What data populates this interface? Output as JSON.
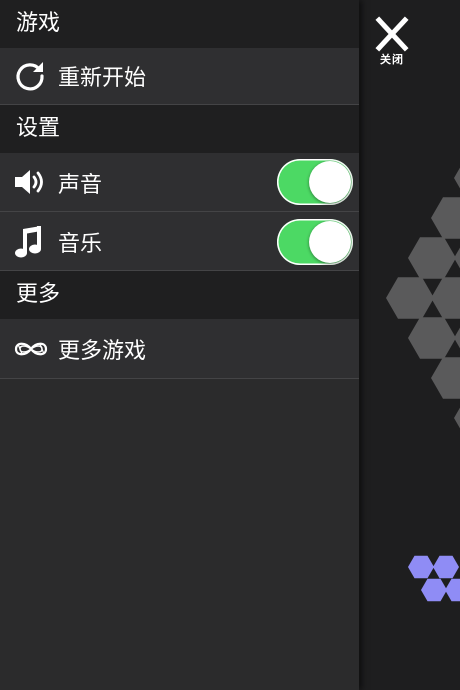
{
  "close": {
    "label": "关闭",
    "icon": "close-icon"
  },
  "sections": {
    "game": {
      "header": "游戏",
      "items": [
        {
          "label": "重新开始",
          "icon": "refresh-icon"
        }
      ]
    },
    "settings": {
      "header": "设置",
      "items": [
        {
          "label": "声音",
          "icon": "speaker-icon",
          "toggle_on": true
        },
        {
          "label": "音乐",
          "icon": "music-note-icon",
          "toggle_on": true
        }
      ]
    },
    "more": {
      "header": "更多",
      "items": [
        {
          "label": "更多游戏",
          "icon": "infinity-link-icon"
        }
      ]
    }
  },
  "colors": {
    "toggle_on": "#4cd964",
    "hex_gray": "#5a5a5b",
    "hex_purple": "#8f8cf5",
    "panel": "#2f2f31",
    "header": "#1f1f20"
  }
}
